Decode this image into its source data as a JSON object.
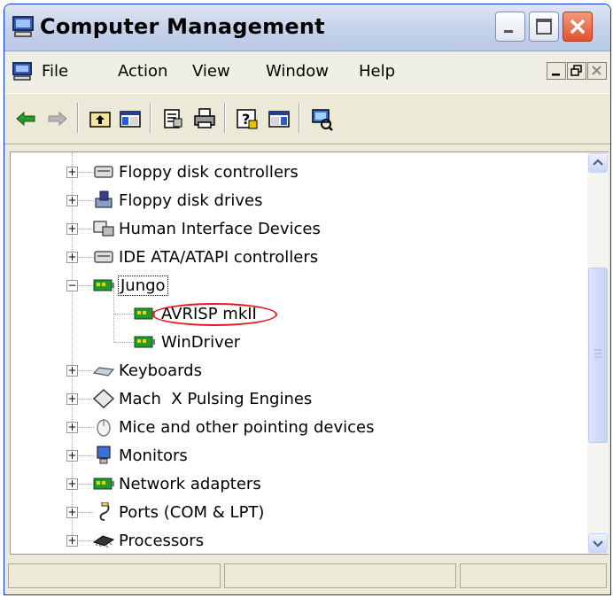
{
  "window": {
    "title": "Computer Management",
    "app_icon": "computer-management-icon",
    "caption_buttons": [
      "minimize-icon",
      "maximize-icon",
      "close-icon"
    ]
  },
  "menubar": {
    "items": [
      {
        "label": "File"
      },
      {
        "label": "Action"
      },
      {
        "label": "View"
      },
      {
        "label": "Window"
      },
      {
        "label": "Help"
      }
    ],
    "mdi_buttons": [
      "mdi-minimize-icon",
      "mdi-restore-icon",
      "mdi-close-icon"
    ]
  },
  "toolbar": {
    "buttons": [
      "back-arrow-icon",
      "forward-arrow-icon",
      "up-folder-icon",
      "show-hide-tree-icon",
      "properties-icon",
      "print-icon",
      "help-icon",
      "console-pane-icon",
      "scan-hardware-icon"
    ]
  },
  "tree": {
    "items": [
      {
        "label": "Floppy disk controllers",
        "icon": "controller-icon",
        "expander": "+"
      },
      {
        "label": "Floppy disk drives",
        "icon": "floppy-drive-icon",
        "expander": "+"
      },
      {
        "label": "Human Interface Devices",
        "icon": "hid-icon",
        "expander": "+"
      },
      {
        "label": "IDE ATA/ATAPI controllers",
        "icon": "controller-icon",
        "expander": "+"
      },
      {
        "label": "Jungo",
        "icon": "green-card-icon",
        "expander": "−",
        "selected": true
      },
      {
        "label": "AVRISP mkII",
        "icon": "green-card-icon",
        "child": true,
        "circled": true
      },
      {
        "label": "WinDriver",
        "icon": "green-card-icon",
        "child": true
      },
      {
        "label": "Keyboards",
        "icon": "keyboard-icon",
        "expander": "+"
      },
      {
        "label": "Mach  X Pulsing Engines",
        "icon": "diamond-icon",
        "expander": "+"
      },
      {
        "label": "Mice and other pointing devices",
        "icon": "mouse-icon",
        "expander": "+"
      },
      {
        "label": "Monitors",
        "icon": "monitor-icon",
        "expander": "+"
      },
      {
        "label": "Network adapters",
        "icon": "green-card-icon",
        "expander": "+"
      },
      {
        "label": "Ports (COM & LPT)",
        "icon": "port-icon",
        "expander": "+"
      },
      {
        "label": "Processors",
        "icon": "processor-icon",
        "expander": "+"
      }
    ]
  },
  "colors": {
    "highlight_oval": "#e8171d",
    "titlebar": "#c6d3ea",
    "close_button": "#e0532e"
  }
}
